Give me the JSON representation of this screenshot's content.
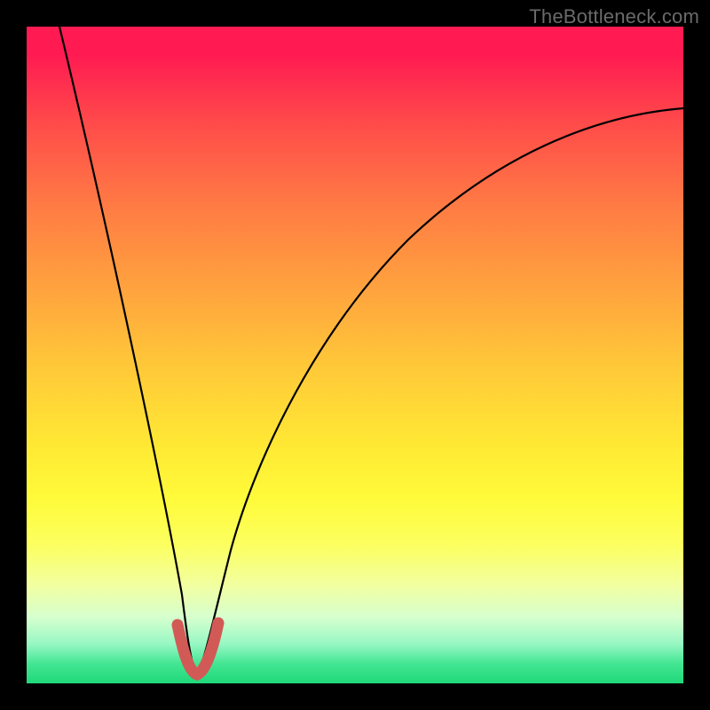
{
  "watermark": "TheBottleneck.com",
  "chart_data": {
    "type": "line",
    "title": "",
    "xlabel": "",
    "ylabel": "",
    "xlim": [
      0,
      100
    ],
    "ylim": [
      0,
      100
    ],
    "series": [
      {
        "name": "bottleneck-curve",
        "x": [
          5,
          8,
          11,
          14,
          17,
          20,
          22,
          23.5,
          24.3,
          24.8,
          25.3,
          26.2,
          27.2,
          28.2,
          29.5,
          31,
          33,
          36,
          40,
          45,
          50,
          56,
          63,
          71,
          80,
          90,
          100
        ],
        "y": [
          100,
          86,
          72,
          58,
          44,
          30,
          18,
          9,
          4,
          1.5,
          1.5,
          4,
          9,
          16,
          24,
          32,
          40,
          49,
          57,
          64,
          69,
          74,
          78,
          81.5,
          84,
          86,
          87.5
        ]
      },
      {
        "name": "highlight-segment",
        "x": [
          22.0,
          22.8,
          23.6,
          24.3,
          24.8,
          25.3,
          26.0,
          26.8,
          27.5,
          28.2
        ],
        "y": [
          9.0,
          6.0,
          3.5,
          1.8,
          1.2,
          1.4,
          2.5,
          4.0,
          6.0,
          8.5
        ]
      }
    ],
    "colors": {
      "curve": "#000000",
      "highlight": "#d25a56"
    }
  }
}
